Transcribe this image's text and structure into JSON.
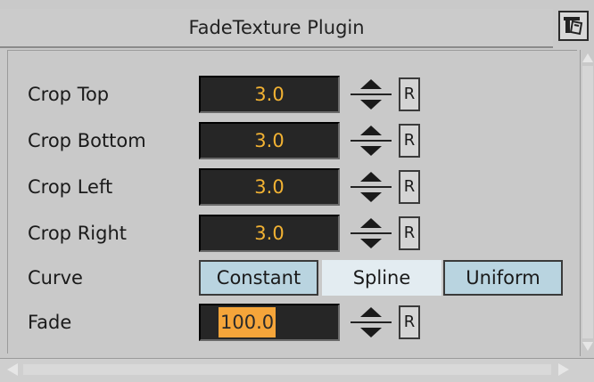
{
  "header": {
    "title": "FadeTexture Plugin",
    "icon": "plugin-menu-icon"
  },
  "rows": [
    {
      "label": "Crop Top",
      "value": "3.0",
      "reset_label": "R"
    },
    {
      "label": "Crop Bottom",
      "value": "3.0",
      "reset_label": "R"
    },
    {
      "label": "Crop Left",
      "value": "3.0",
      "reset_label": "R"
    },
    {
      "label": "Crop Right",
      "value": "3.0",
      "reset_label": "R"
    }
  ],
  "curve": {
    "label": "Curve",
    "options": [
      "Constant",
      "Spline",
      "Uniform"
    ],
    "selected": "Spline"
  },
  "fade": {
    "label": "Fade",
    "value": "100.0",
    "reset_label": "R"
  },
  "colors": {
    "value_text": "#f2b233",
    "value_bg": "#262626",
    "selection": "#f5a53a",
    "button_bg": "#b9d4e0",
    "button_selected_bg": "#e3ecf1"
  }
}
